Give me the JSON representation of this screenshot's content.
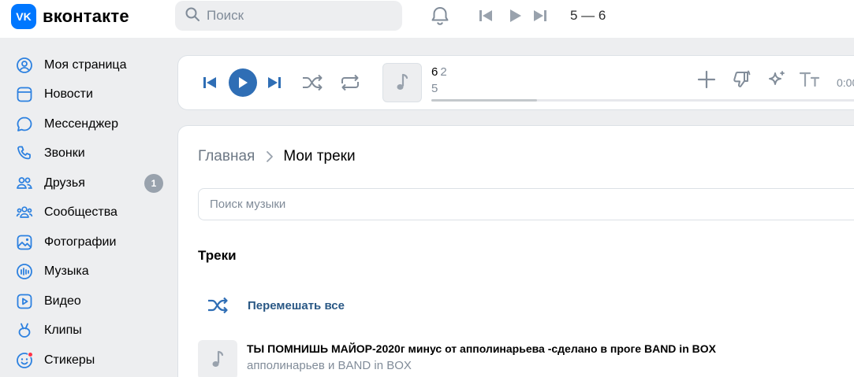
{
  "header": {
    "logo_text": "вконтакте",
    "logo_badge": "VK",
    "search_placeholder": "Поиск",
    "now_playing": "5 — 6"
  },
  "sidebar": {
    "items": [
      {
        "label": "Моя страница",
        "icon": "user-circle-icon"
      },
      {
        "label": "Новости",
        "icon": "news-icon"
      },
      {
        "label": "Мессенджер",
        "icon": "message-icon"
      },
      {
        "label": "Звонки",
        "icon": "phone-icon"
      },
      {
        "label": "Друзья",
        "icon": "friends-icon",
        "badge": "1"
      },
      {
        "label": "Сообщества",
        "icon": "communities-icon"
      },
      {
        "label": "Фотографии",
        "icon": "photo-icon"
      },
      {
        "label": "Музыка",
        "icon": "music-icon"
      },
      {
        "label": "Видео",
        "icon": "video-icon"
      },
      {
        "label": "Клипы",
        "icon": "clips-icon"
      },
      {
        "label": "Стикеры",
        "icon": "stickers-icon"
      }
    ]
  },
  "player": {
    "title": "6",
    "title_artist": "2",
    "subtitle": "5",
    "time": "0:00",
    "progress": 0.24
  },
  "main": {
    "breadcrumb_home": "Главная",
    "breadcrumb_current": "Мои треки",
    "search_placeholder": "Поиск музыки",
    "section_title": "Треки",
    "shuffle_label": "Перемешать все",
    "tracks": [
      {
        "title": "ТЫ ПОМНИШЬ МАЙОР-2020г минус от апполинарьева -сделано в проге BAND in BOX",
        "artist": "апполинарьев и BAND in BOX"
      }
    ]
  },
  "colors": {
    "accent": "#2f6eb5",
    "brand": "#0077ff",
    "link": "#2a5885",
    "icon": "#2d81e0",
    "muted": "#818c99",
    "background": "#edeef0"
  }
}
